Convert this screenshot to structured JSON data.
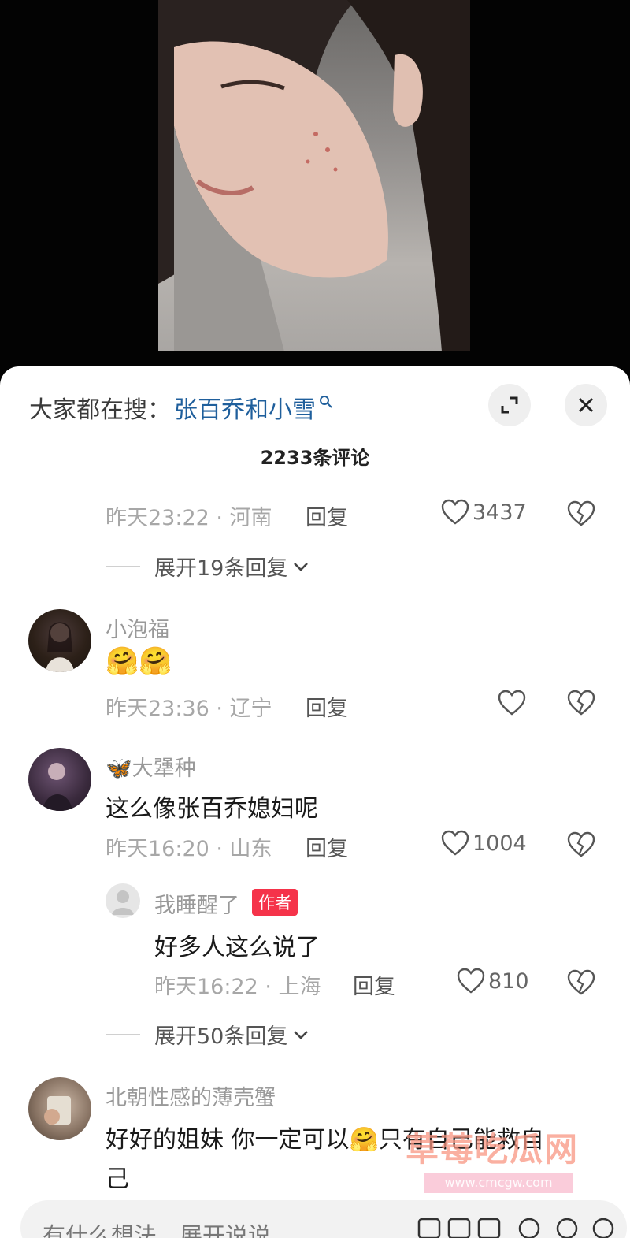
{
  "search": {
    "prefix": "大家都在搜：",
    "term": "张百乔和小雪"
  },
  "comments_count": "2233条评论",
  "first_comment_tail": {
    "time": "昨天23:22 · 河南",
    "reply": "回复",
    "likes": "3437",
    "expand": "展开19条回复"
  },
  "comments": [
    {
      "user": "小泡福",
      "text": "🤗🤗",
      "time": "昨天23:36 · 辽宁",
      "reply": "回复",
      "likes": ""
    },
    {
      "user_prefix": "🦋",
      "user": "大犟种",
      "text": "这么像张百乔媳妇呢",
      "time": "昨天16:20 · 山东",
      "reply": "回复",
      "likes": "1004",
      "sub_reply": {
        "user": "我睡醒了",
        "badge": "作者",
        "text": "好多人这么说了",
        "time": "昨天16:22 · 上海",
        "reply": "回复",
        "likes": "810"
      },
      "expand": "展开50条回复"
    },
    {
      "user": "北朝性感的薄壳蟹",
      "text_line1": "好好的姐妹 你一定可以🤗只有自己能救自",
      "text_line2": "己"
    }
  ],
  "watermark": {
    "main": "草莓吃瓜网",
    "sub": "www.cmcgw.com"
  },
  "input": {
    "placeholder": "有什么想法，展开说说"
  },
  "icons": [
    "search-icon",
    "expand-icon",
    "close-icon",
    "heart-icon",
    "broken-heart-icon",
    "chevron-down-icon"
  ]
}
